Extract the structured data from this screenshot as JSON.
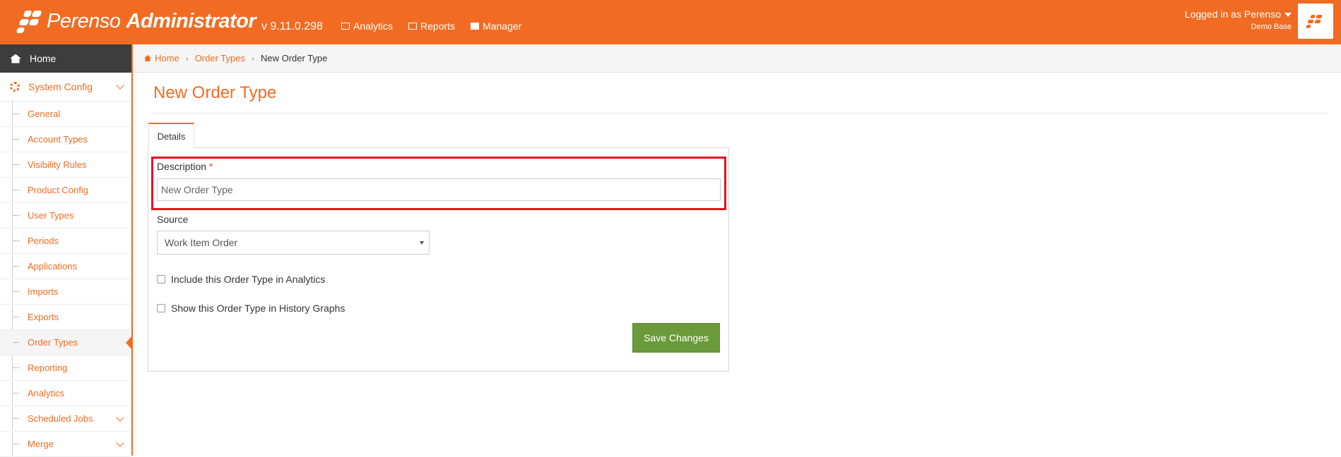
{
  "header": {
    "brand_name": "Perenso",
    "brand_suffix": "Administrator",
    "version": "v 9.11.0.298",
    "nav": [
      {
        "label": "Analytics",
        "icon": "bar-chart-icon"
      },
      {
        "label": "Reports",
        "icon": "table-icon"
      },
      {
        "label": "Manager",
        "icon": "briefcase-icon"
      }
    ],
    "user_text": "Logged in as Perenso",
    "database": "Demo Base"
  },
  "sidebar": {
    "home": "Home",
    "section": "System Config",
    "items": [
      {
        "label": "General"
      },
      {
        "label": "Account Types"
      },
      {
        "label": "Visibility Rules"
      },
      {
        "label": "Product Config"
      },
      {
        "label": "User Types"
      },
      {
        "label": "Periods"
      },
      {
        "label": "Applications"
      },
      {
        "label": "Imports"
      },
      {
        "label": "Exports"
      },
      {
        "label": "Order Types",
        "active": true
      },
      {
        "label": "Reporting"
      },
      {
        "label": "Analytics"
      },
      {
        "label": "Scheduled Jobs",
        "expandable": true
      },
      {
        "label": "Merge",
        "expandable": true
      }
    ]
  },
  "breadcrumb": {
    "home": "Home",
    "parent": "Order Types",
    "current": "New Order Type"
  },
  "page": {
    "title": "New Order Type",
    "tab": "Details"
  },
  "form": {
    "description_label": "Description",
    "required_mark": "*",
    "description_placeholder": "New Order Type",
    "source_label": "Source",
    "source_value": "Work Item Order",
    "analytics_checkbox": {
      "label": "Include this Order Type in Analytics",
      "checked": false
    },
    "history_checkbox": {
      "label": "Show this Order Type in History Graphs",
      "checked": false
    },
    "save_label": "Save Changes"
  },
  "colors": {
    "accent": "#f26b22",
    "highlight": "#e3141f",
    "save": "#6b9a3a",
    "sidebar_home": "#3d3d3d"
  }
}
